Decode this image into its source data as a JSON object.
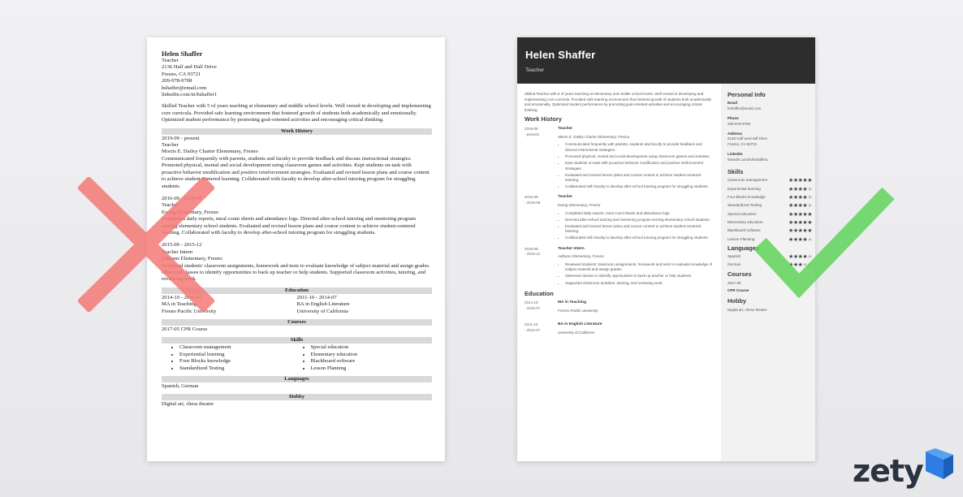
{
  "plain_resume": {
    "name": "Helen Shaffer",
    "title": "Teacher",
    "address": "2136 Half and Half Drive",
    "city": "Fresno, CA 93721",
    "phone": "209-978-9708",
    "email": "hshaffer@email.com",
    "linkedin": "linkedin.com/in/hshaffer1",
    "summary": "Skilled Teacher with 5 of years teaching at elementary and middle school levels. Well versed in developing and implementing core curricula. Provided safe learning environment that fostered growth of students both academically and emotionally. Optimized student performance by promoting goal-oriented activities and encouraging critical thinking.",
    "work_history_heading": "Work History",
    "jobs": [
      {
        "dates": "2019-09 - present",
        "title": "Teacher",
        "company": "Morris E. Dailey Charter Elementary, Fresno",
        "desc": "Communicated frequently with parents, students and faculty to provide feedback and discuss instructional strategies. Promoted physical, mental and social development using classroom games and activities. Kept students on-task with proactive behavior modification and positive reinforcement strategies. Evaluated and revised lesson plans and course content to achieve student-centered learning. Collaborated with faculty to develop after-school tutoring program for struggling students."
      },
      {
        "dates": "2016-09 - 2019-08",
        "title": "Teacher",
        "company": "Ewing Elementary, Fresno",
        "desc": "Completed daily reports, meal count sheets and attendance logs. Directed after-school tutoring and mentoring program serving elementary school students. Evaluated and revised lesson plans and course content to achieve student-centered learning. Collaborated with faculty to develop after-school tutoring program for struggling students."
      },
      {
        "dates": "2015-09 - 2015-12",
        "title": "Teacher Intern",
        "company": "Addams Elementary, Fresno",
        "desc": "Reviewed students' classroom assignments, homework and tests to evaluate knowledge of subject material and assign grades. Observed classes to identify opportunities to back up teacher or help students. Supported classroom activities, tutoring, and reviewing work."
      }
    ],
    "education_heading": "Education",
    "education": [
      {
        "dates": "2014-10 - 2016-07",
        "degree": "MA in Teaching",
        "school": "Fresno Pacific University"
      },
      {
        "dates": "2011-10 - 2014-07",
        "degree": "BA in English Literature",
        "school": "University of California"
      }
    ],
    "courses_heading": "Courses",
    "course": "2017-05  CPR Course",
    "skills_heading": "Skills",
    "skills_col1": [
      "Classroom management",
      "Experiential learning",
      "Four Blocks knowledge",
      "Standardized Testing"
    ],
    "skills_col2": [
      "Special education",
      "Elementary education",
      "Blackboard software",
      "Lesson Planning"
    ],
    "languages_heading": "Languages",
    "languages": "Spanish, German",
    "hobby_heading": "Hobby",
    "hobby": "Digital art, chess theatre"
  },
  "designed_resume": {
    "name": "Helen Shaffer",
    "title": "Teacher",
    "summary": "Skilled Teacher with 5 of years teaching at elementary and middle school levels. Well versed in developing and implementing core curricula. Provided safe learning environment that fostered growth of students both academically and emotionally. Optimized student performance by promoting goal-oriented activities and encouraging critical thinking.",
    "work_history_heading": "Work History",
    "jobs": [
      {
        "date1": "2019-09",
        "date2": "- present",
        "title": "Teacher",
        "company": "Morris E. Dailey Charter Elementary, Fresno",
        "bullets": [
          "Communicated frequently with parents, students and faculty to provide feedback and discuss instructional strategies.",
          "Promoted physical, mental and social development using classroom games and activities.",
          "Kept students on-task with proactive behavior modification and positive reinforcement strategies.",
          "Evaluated and revised lesson plans and course content to achieve student-centered learning.",
          "Collaborated with faculty to develop after-school tutoring program for struggling students."
        ]
      },
      {
        "date1": "2016-09",
        "date2": "- 2019-08",
        "title": "Teacher",
        "company": "Ewing Elementary, Fresno",
        "bullets": [
          "Completed daily reports, meal count sheets and attendance logs.",
          "Directed after-school tutoring and mentoring program serving elementary school students.",
          "Evaluated and revised lesson plans and course content to achieve student-centered learning.",
          "Collaborated with faculty to develop after-school tutoring program for struggling students."
        ]
      },
      {
        "date1": "2015-09",
        "date2": "- 2015-12",
        "title": "Teacher Intern",
        "company": "Addams Elementary, Fresno",
        "bullets": [
          "Reviewed students' classroom assignments, homework and tests to evaluate knowledge of subject material and assign grades.",
          "Observed classes to identify opportunities to back up teacher or help students.",
          "Supported classroom activities, tutoring, and reviewing work."
        ]
      }
    ],
    "education_heading": "Education",
    "education": [
      {
        "date1": "2014-10",
        "date2": "- 2016-07",
        "degree": "MA in Teaching",
        "school": "Fresno Pacific University"
      },
      {
        "date1": "2011-10",
        "date2": "- 2014-07",
        "degree": "BA in English Literature",
        "school": "University of California"
      }
    ],
    "personal_info_heading": "Personal Info",
    "email_label": "Email",
    "email": "hshaffer@email.com",
    "phone_label": "Phone",
    "phone": "209-978-9708",
    "address_label": "Address",
    "address1": "2136 Half and Half Drive",
    "address2": "Fresno, CA 93721",
    "linkedin_label": "LinkedIn",
    "linkedin": "linkedin.com/in/hshaffer1",
    "skills_heading": "Skills",
    "skills": [
      {
        "name": "Classroom management",
        "rating": 5
      },
      {
        "name": "Experiential learning",
        "rating": 4
      },
      {
        "name": "Four Blocks knowledge",
        "rating": 4
      },
      {
        "name": "Standardized Testing",
        "rating": 4
      },
      {
        "name": "Special education",
        "rating": 5
      },
      {
        "name": "Elementary education",
        "rating": 5
      },
      {
        "name": "Blackboard software",
        "rating": 5
      },
      {
        "name": "Lesson Planning",
        "rating": 4
      }
    ],
    "languages_heading": "Languages",
    "languages": [
      {
        "name": "Spanish",
        "rating": 4
      },
      {
        "name": "German",
        "rating": 3
      }
    ],
    "courses_heading": "Courses",
    "course_date": "2017-05",
    "course_name": "CPR Course",
    "hobby_heading": "Hobby",
    "hobby": "Digital art, chess theatre"
  },
  "colors": {
    "wrong_mark": "#f47b77",
    "right_mark": "#5fd35a",
    "header_bg": "#2d2d2d",
    "logo_text": "#2a3340",
    "logo_blue": "#2d7de3"
  },
  "logo": {
    "text": "zety"
  },
  "icons": {
    "wrong": "x-mark-icon",
    "right": "check-mark-icon",
    "logo": "zety-cube-icon"
  }
}
